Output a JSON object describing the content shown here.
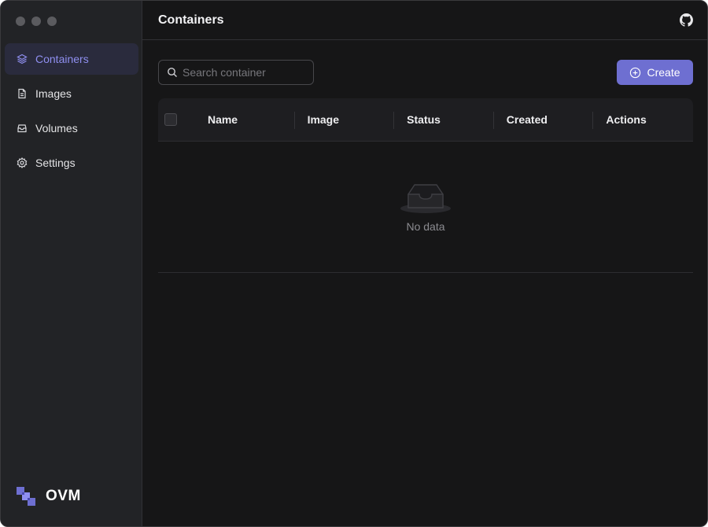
{
  "sidebar": {
    "items": [
      {
        "label": "Containers",
        "icon": "containers-icon",
        "active": true
      },
      {
        "label": "Images",
        "icon": "file-icon"
      },
      {
        "label": "Volumes",
        "icon": "box-icon"
      },
      {
        "label": "Settings",
        "icon": "gear-icon"
      }
    ],
    "brand": "OVM"
  },
  "header": {
    "title": "Containers",
    "github_icon": "github-icon"
  },
  "toolbar": {
    "search_placeholder": "Search container",
    "create_label": "Create"
  },
  "table": {
    "columns": [
      "Name",
      "Image",
      "Status",
      "Created",
      "Actions"
    ],
    "rows": [],
    "empty_text": "No data"
  },
  "colors": {
    "accent": "#6e6fd1",
    "active_text": "#8f8ff0"
  }
}
